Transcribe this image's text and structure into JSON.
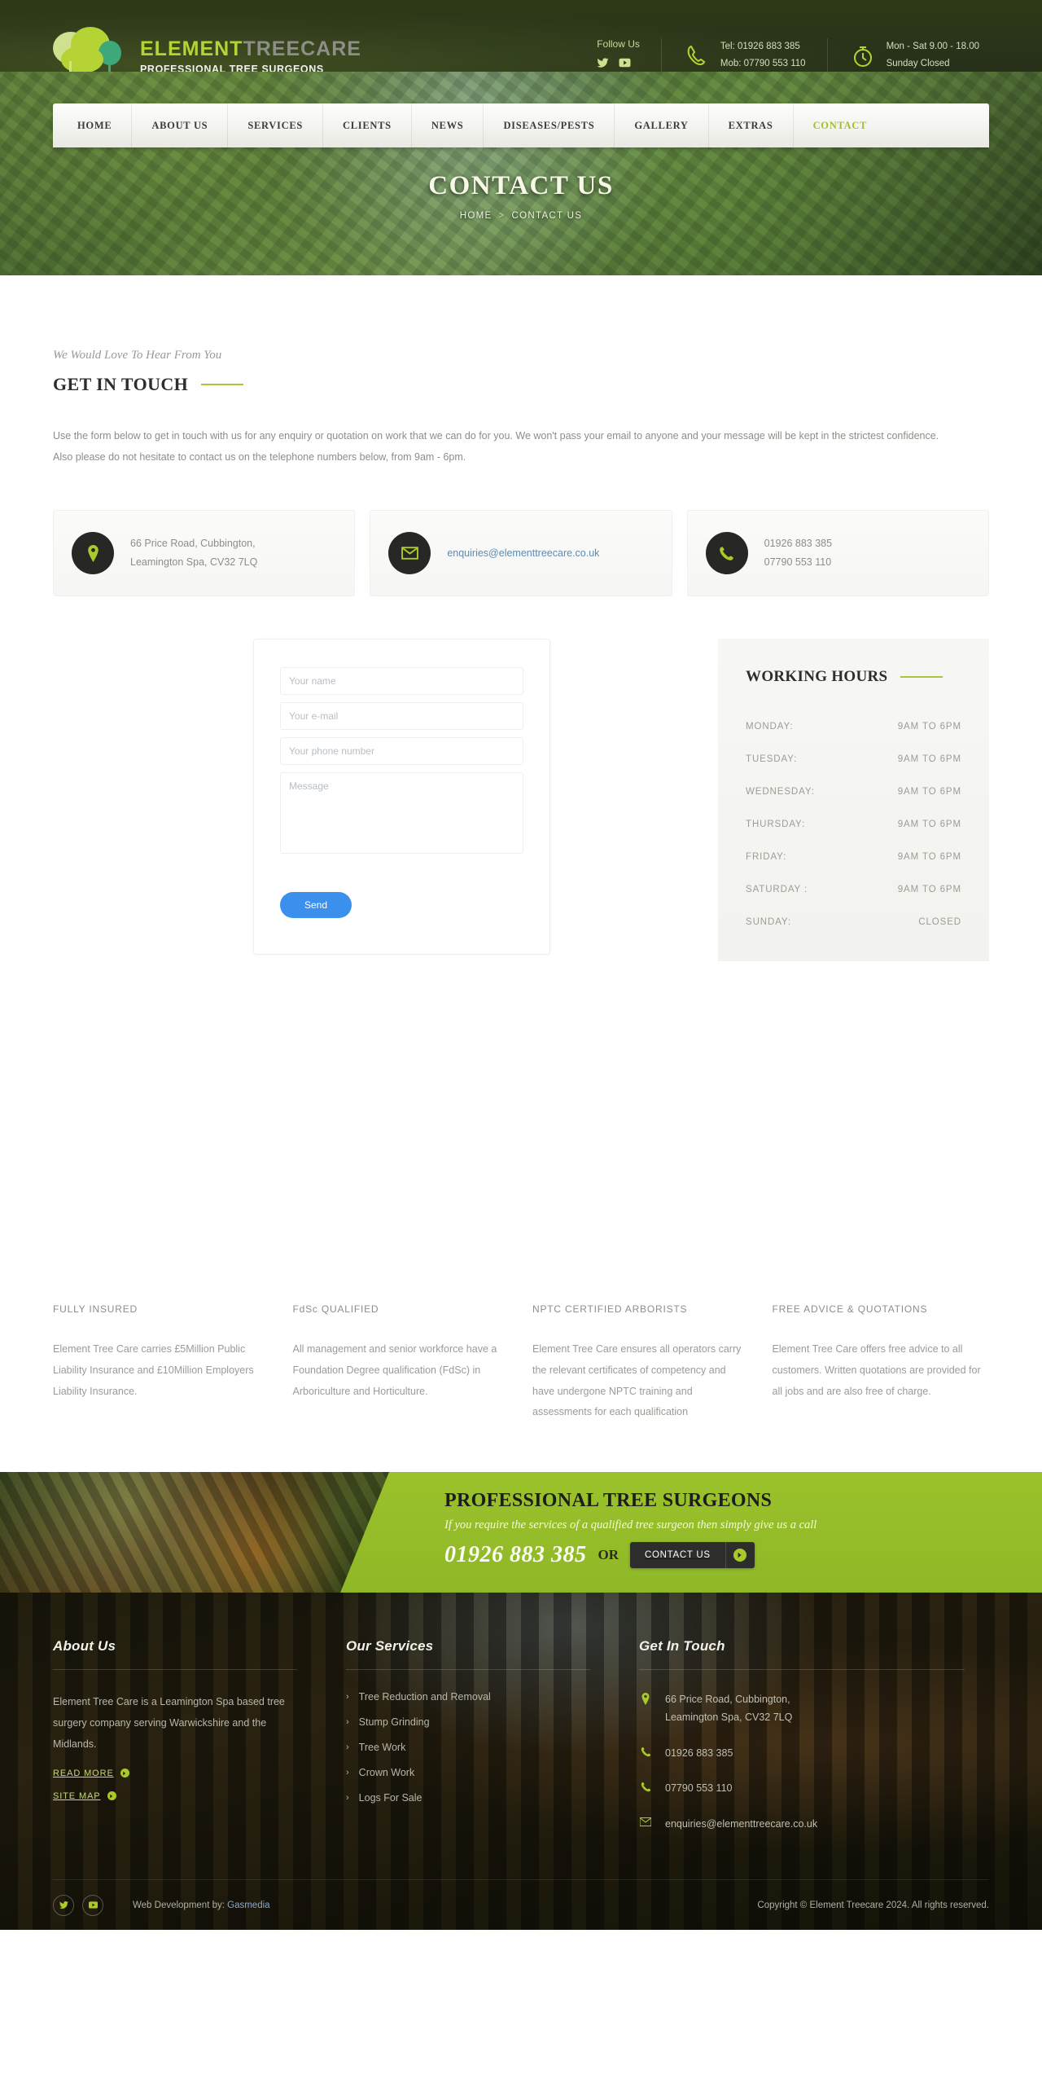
{
  "header": {
    "logo": {
      "brand_first": "ELEMENT",
      "brand_second": "TREECARE",
      "tagline": "PROFESSIONAL TREE SURGEONS"
    },
    "follow_label": "Follow Us",
    "social": [
      {
        "name": "twitter-icon",
        "label": "Twitter"
      },
      {
        "name": "youtube-icon",
        "label": "YouTube"
      }
    ],
    "phone_tel": "Tel: 01926 883 385",
    "phone_mob": "Mob: 07790 553 110",
    "hours_weekday": "Mon - Sat 9.00 - 18.00",
    "hours_sunday": "Sunday Closed"
  },
  "nav": {
    "items": [
      {
        "label": "HOME",
        "active": false
      },
      {
        "label": "ABOUT US",
        "active": false
      },
      {
        "label": "SERVICES",
        "active": false
      },
      {
        "label": "CLIENTS",
        "active": false
      },
      {
        "label": "NEWS",
        "active": false
      },
      {
        "label": "DISEASES/PESTS",
        "active": false
      },
      {
        "label": "GALLERY",
        "active": false
      },
      {
        "label": "EXTRAS",
        "active": false
      },
      {
        "label": "CONTACT",
        "active": true
      }
    ]
  },
  "hero": {
    "title": "CONTACT US",
    "crumb_home": "HOME",
    "crumb_sep": ">",
    "crumb_current": "CONTACT US"
  },
  "intro": {
    "eyebrow": "We Would Love To Hear From You",
    "heading": "GET IN TOUCH",
    "paragraph": "Use the form below to get in touch with us for any enquiry or quotation on work that we can do for you. We won't pass your email to anyone and your message will be kept in the strictest confidence. Also please do not hesitate to contact us on the telephone numbers below, from 9am - 6pm."
  },
  "info_boxes": [
    {
      "icon": "map-pin-icon",
      "line1": "66 Price Road, Cubbington,",
      "line2": "Leamington Spa, CV32 7LQ",
      "type": "text"
    },
    {
      "icon": "envelope-icon",
      "line1": "enquiries@elementtreecare.co.uk",
      "line2": "",
      "type": "link"
    },
    {
      "icon": "phone-icon",
      "line1": "01926 883 385",
      "line2": "07790 553 110",
      "type": "text"
    }
  ],
  "form": {
    "name_placeholder": "Your name",
    "email_placeholder": "Your e-mail",
    "phone_placeholder": "Your phone number",
    "message_placeholder": "Message",
    "name_value": "",
    "email_value": "",
    "phone_value": "",
    "message_value": "",
    "send_label": "Send",
    "send_color": "#3b90ee"
  },
  "working_hours": {
    "title": "WORKING HOURS",
    "rows": [
      {
        "day": "MONDAY:",
        "time": "9AM TO 6PM"
      },
      {
        "day": "TUESDAY:",
        "time": "9AM TO 6PM"
      },
      {
        "day": "WEDNESDAY:",
        "time": "9AM TO 6PM"
      },
      {
        "day": "THURSDAY:",
        "time": "9AM TO 6PM"
      },
      {
        "day": "FRIDAY:",
        "time": "9AM TO 6PM"
      },
      {
        "day": "SATURDAY :",
        "time": "9AM TO 6PM"
      },
      {
        "day": "SUNDAY:",
        "time": "CLOSED"
      }
    ]
  },
  "features": [
    {
      "title": "FULLY INSURED",
      "body": "Element Tree Care carries £5Million Public Liability Insurance and £10Million Employers Liability Insurance."
    },
    {
      "title": "FdSc QUALIFIED",
      "body": "All management and senior workforce have a Foundation Degree qualification (FdSc) in Arboriculture and Horticulture."
    },
    {
      "title": "NPTC CERTIFIED ARBORISTS",
      "body": "Element Tree Care ensures all operators carry the relevant certificates of competency and have undergone NPTC training and assessments for each qualification"
    },
    {
      "title": "FREE ADVICE & QUOTATIONS",
      "body": "Element Tree Care offers free advice to all customers. Written quotations are provided for all jobs and are also free of charge."
    }
  ],
  "cta": {
    "title": "PROFESSIONAL TREE SURGEONS",
    "subtitle": "If you require the services of a qualified tree surgeon then simply give us a call",
    "phone": "01926 883 385",
    "or": "OR",
    "button_label": "CONTACT US",
    "accent": "#9bc22b"
  },
  "footer": {
    "about": {
      "title": "About Us",
      "body": "Element Tree Care is a Leamington Spa based tree surgery company serving Warwickshire and the Midlands.",
      "link_read_more": "READ MORE",
      "link_site_map": "SITE MAP"
    },
    "services": {
      "title": "Our Services",
      "items": [
        "Tree Reduction and Removal",
        "Stump Grinding",
        "Tree Work",
        "Crown Work",
        "Logs For Sale"
      ]
    },
    "contact": {
      "title": "Get In Touch",
      "address_line1": "66 Price Road, Cubbington,",
      "address_line2": "Leamington Spa, CV32 7LQ",
      "phone1": "01926 883 385",
      "phone2": "07790 553 110",
      "email": "enquiries@elementtreecare.co.uk"
    },
    "bottom": {
      "webdev_prefix": "Web Development by:",
      "webdev_name": "Gasmedia",
      "copyright": "Copyright © Element Treecare 2024. All rights reserved."
    }
  }
}
